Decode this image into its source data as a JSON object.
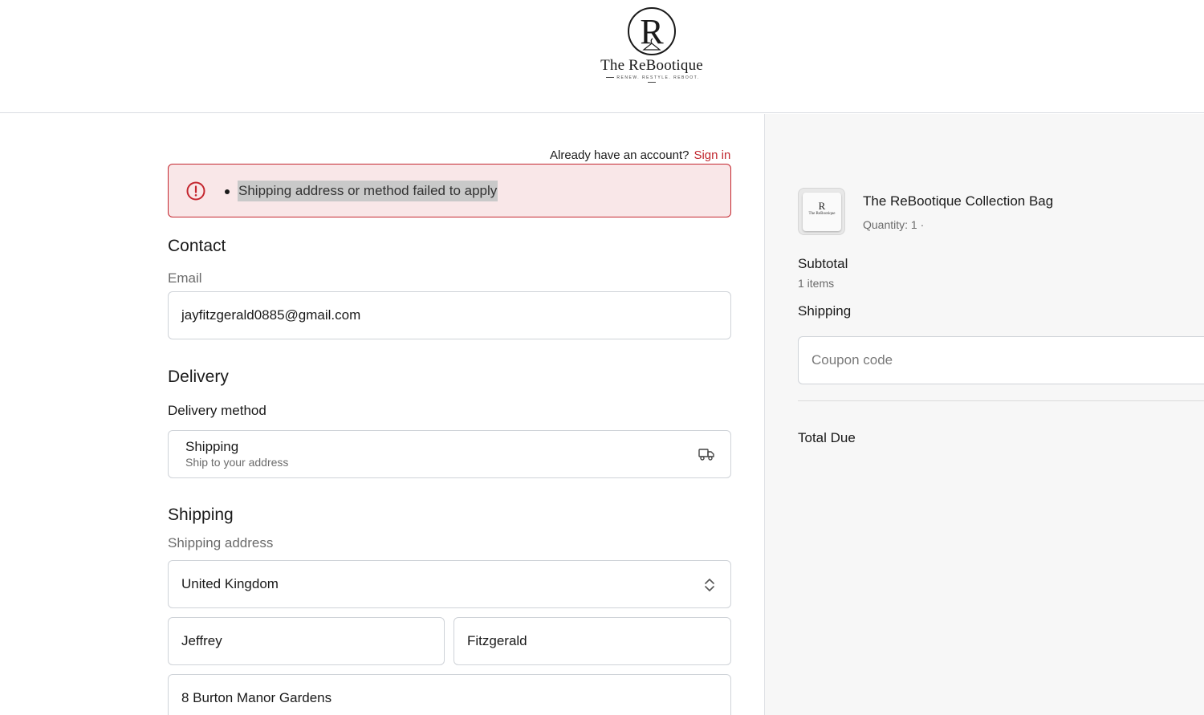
{
  "brand": {
    "name": "The ReBootique",
    "monogram": "R",
    "tagline": "RENEW. RESTYLE. REBOOT."
  },
  "account": {
    "prompt": "Already have an account?",
    "sign_in_label": "Sign in"
  },
  "error": {
    "message": "Shipping address or method failed to apply",
    "color": "#c4262e"
  },
  "contact": {
    "title": "Contact",
    "email_label": "Email",
    "email_value": "jayfitzgerald0885@gmail.com"
  },
  "delivery": {
    "title": "Delivery",
    "method_label": "Delivery method",
    "option_title": "Shipping",
    "option_subtitle": "Ship to your address",
    "option_icon": "truck-icon"
  },
  "shipping": {
    "title": "Shipping",
    "address_label": "Shipping address",
    "country": "United Kingdom",
    "first_name": "Jeffrey",
    "last_name": "Fitzgerald",
    "address_line1": "8 Burton Manor Gardens"
  },
  "order_summary": {
    "product_name": "The ReBootique Collection Bag",
    "product_quantity": "Quantity: 1 ·",
    "thumb_monogram": "R",
    "thumb_name": "The ReBootique",
    "subtotal_label": "Subtotal",
    "items_count": "1 items",
    "shipping_label": "Shipping",
    "coupon_placeholder": "Coupon code",
    "total_label": "Total Due"
  },
  "colors": {
    "accent": "#c0252d",
    "error_bg": "#f9e7e8",
    "summary_bg": "#f7f7f7"
  }
}
